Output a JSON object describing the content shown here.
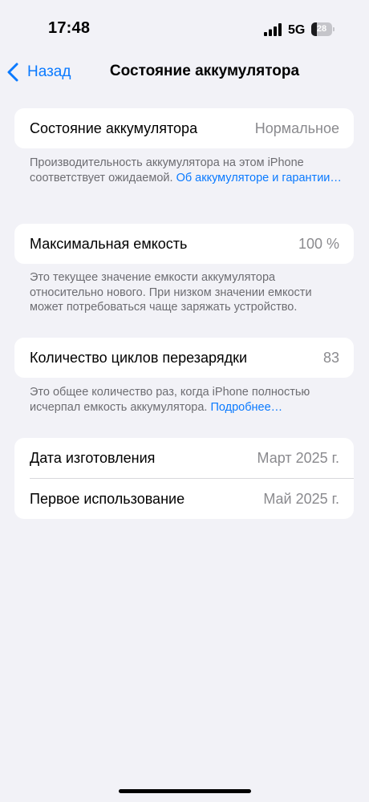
{
  "status_bar": {
    "time": "17:48",
    "network": "5G",
    "battery_level": "28",
    "battery_fraction": 0.28
  },
  "nav": {
    "back_label": "Назад",
    "title": "Состояние аккумулятора"
  },
  "battery_health": {
    "label": "Состояние аккумулятора",
    "value": "Нормальное",
    "footer_text": "Производительность аккумулятора на этом iPhone соответствует ожидаемой.",
    "footer_link": "Об аккумуляторе и гарантии…"
  },
  "max_capacity": {
    "label": "Максимальная емкость",
    "value": "100 %",
    "footer_text": "Это текущее значение емкости аккумулятора относительно нового. При низком значении емкости может потребоваться чаще заряжать устройство."
  },
  "cycle_count": {
    "label": "Количество циклов перезарядки",
    "value": "83",
    "footer_text": "Это общее количество раз, когда iPhone полностью исчерпал емкость аккумулятора.",
    "footer_link": "Подробнее…"
  },
  "dates": {
    "manufacture_label": "Дата изготовления",
    "manufacture_value": "Март 2025 г.",
    "first_use_label": "Первое использование",
    "first_use_value": "Май 2025 г."
  },
  "colors": {
    "accent": "#0a7aff",
    "background": "#f2f2f7",
    "secondary_text": "#8a8a8e"
  }
}
